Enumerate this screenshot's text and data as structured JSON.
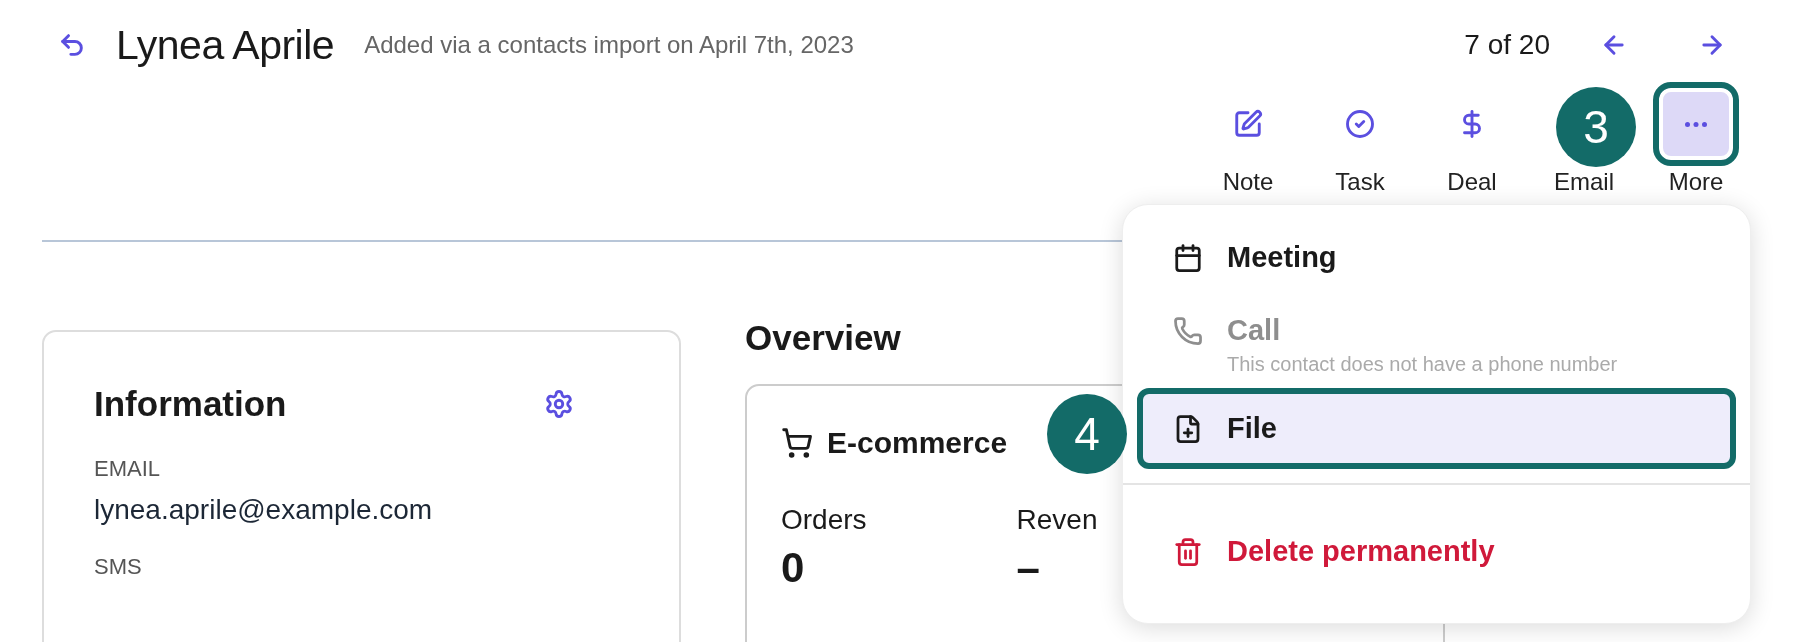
{
  "header": {
    "title": "Lynea Aprile",
    "subtitle": "Added via a contacts import on April 7th, 2023",
    "pager": "7 of 20"
  },
  "actions": [
    {
      "label": "Note",
      "selected": false
    },
    {
      "label": "Task",
      "selected": false
    },
    {
      "label": "Deal",
      "selected": false
    },
    {
      "label": "Email",
      "selected": false
    },
    {
      "label": "More",
      "selected": true,
      "callout": "3"
    }
  ],
  "information": {
    "title": "Information",
    "fields": [
      {
        "label": "EMAIL",
        "value": "lynea.aprile@example.com"
      },
      {
        "label": "SMS"
      }
    ]
  },
  "overview": {
    "title": "Overview",
    "card": {
      "title": "E-commerce",
      "stats": [
        {
          "label": "Orders",
          "value": "0"
        },
        {
          "label": "Reven",
          "value": "–"
        }
      ]
    }
  },
  "menu": {
    "items": [
      {
        "kind": "item",
        "label": "Meeting",
        "disabled": false,
        "selected": false
      },
      {
        "kind": "item",
        "label": "Call",
        "hint": "This contact does not have a phone number",
        "disabled": true,
        "selected": false
      },
      {
        "kind": "item",
        "label": "File",
        "disabled": false,
        "selected": true,
        "callout": "4"
      },
      {
        "kind": "divider"
      },
      {
        "kind": "danger",
        "label": "Delete permanently",
        "disabled": false,
        "selected": false
      }
    ]
  }
}
